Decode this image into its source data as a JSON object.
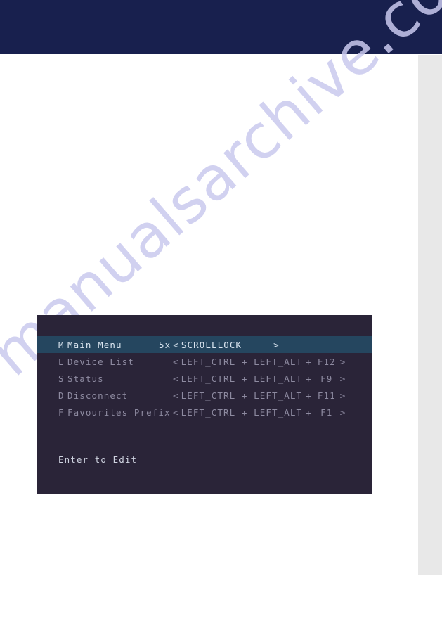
{
  "page": {
    "background_color": "#ffffff",
    "header_color": "#18204e",
    "side_strip_color": "#e8e8e8"
  },
  "watermark": {
    "text": "manualsarchive.com",
    "color": "#c9c9ee"
  },
  "osd": {
    "background_color": "#2a2438",
    "selected_row_color": "#25465f",
    "text_color": "#8d8aa0",
    "selected_text_color": "#d9e4ef",
    "hint": "Enter to Edit",
    "rows": [
      {
        "key": "M",
        "label": "Main Menu",
        "prefix": "5x",
        "open": "<",
        "combo": "SCROLLLOCK",
        "plus": "",
        "fkey": "",
        "close": ">",
        "selected": true
      },
      {
        "key": "L",
        "label": "Device List",
        "prefix": "",
        "open": "<",
        "combo": "LEFT_CTRL + LEFT_ALT",
        "plus": "+",
        "fkey": "F12",
        "close": ">",
        "selected": false
      },
      {
        "key": "S",
        "label": "Status",
        "prefix": "",
        "open": "<",
        "combo": "LEFT_CTRL + LEFT_ALT",
        "plus": "+",
        "fkey": "F9",
        "close": ">",
        "selected": false
      },
      {
        "key": "D",
        "label": "Disconnect",
        "prefix": "",
        "open": "<",
        "combo": "LEFT_CTRL + LEFT_ALT",
        "plus": "+",
        "fkey": "F11",
        "close": ">",
        "selected": false
      },
      {
        "key": "F",
        "label": "Favourites Prefix",
        "prefix": "",
        "open": "<",
        "combo": "LEFT_CTRL + LEFT_ALT",
        "plus": "+",
        "fkey": "F1",
        "close": ">",
        "selected": false
      }
    ]
  }
}
